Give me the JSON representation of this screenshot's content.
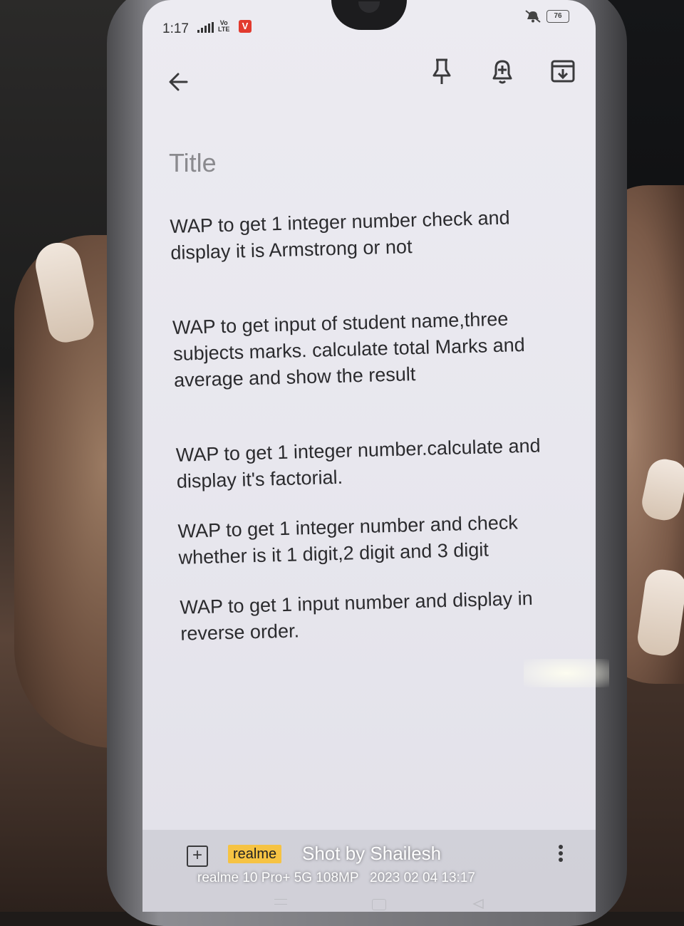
{
  "status_bar": {
    "time": "1:17",
    "volte": [
      "Vo",
      "LTE"
    ],
    "app_badge": "V",
    "battery": "76"
  },
  "toolbar": {
    "icons": [
      "back-arrow-icon",
      "pin-icon",
      "add-reminder-icon",
      "archive-icon"
    ]
  },
  "note": {
    "title_placeholder": "Title",
    "paragraphs": [
      "WAP to get 1 integer number check and\ndisplay it is Armstrong or not",
      "WAP to get input of student name,three\nsubjects marks. calculate total Marks and\naverage and show the result",
      "WAP to get 1 integer number.calculate and\ndisplay it's factorial.",
      "WAP to get 1 integer number and check\nwhether is it 1 digit,2 digit and 3 digit",
      "WAP to get 1 input number and display in\nreverse order."
    ]
  },
  "bottom_bar": {
    "add_icon": "add-box-icon",
    "more_icon": "more-vert-icon"
  },
  "watermark": {
    "brand": "realme",
    "shot_by": "Shot by Shailesh",
    "device": "realme 10 Pro+ 5G 108MP",
    "datetime": "2023 02 04 13:17"
  },
  "colors": {
    "screen_bg": "#ebeaf0",
    "text": "#2b2b2e",
    "placeholder": "#8a8a8e",
    "watermark_brand_bg": "#f6c343",
    "badge_red": "#e23a2e"
  }
}
